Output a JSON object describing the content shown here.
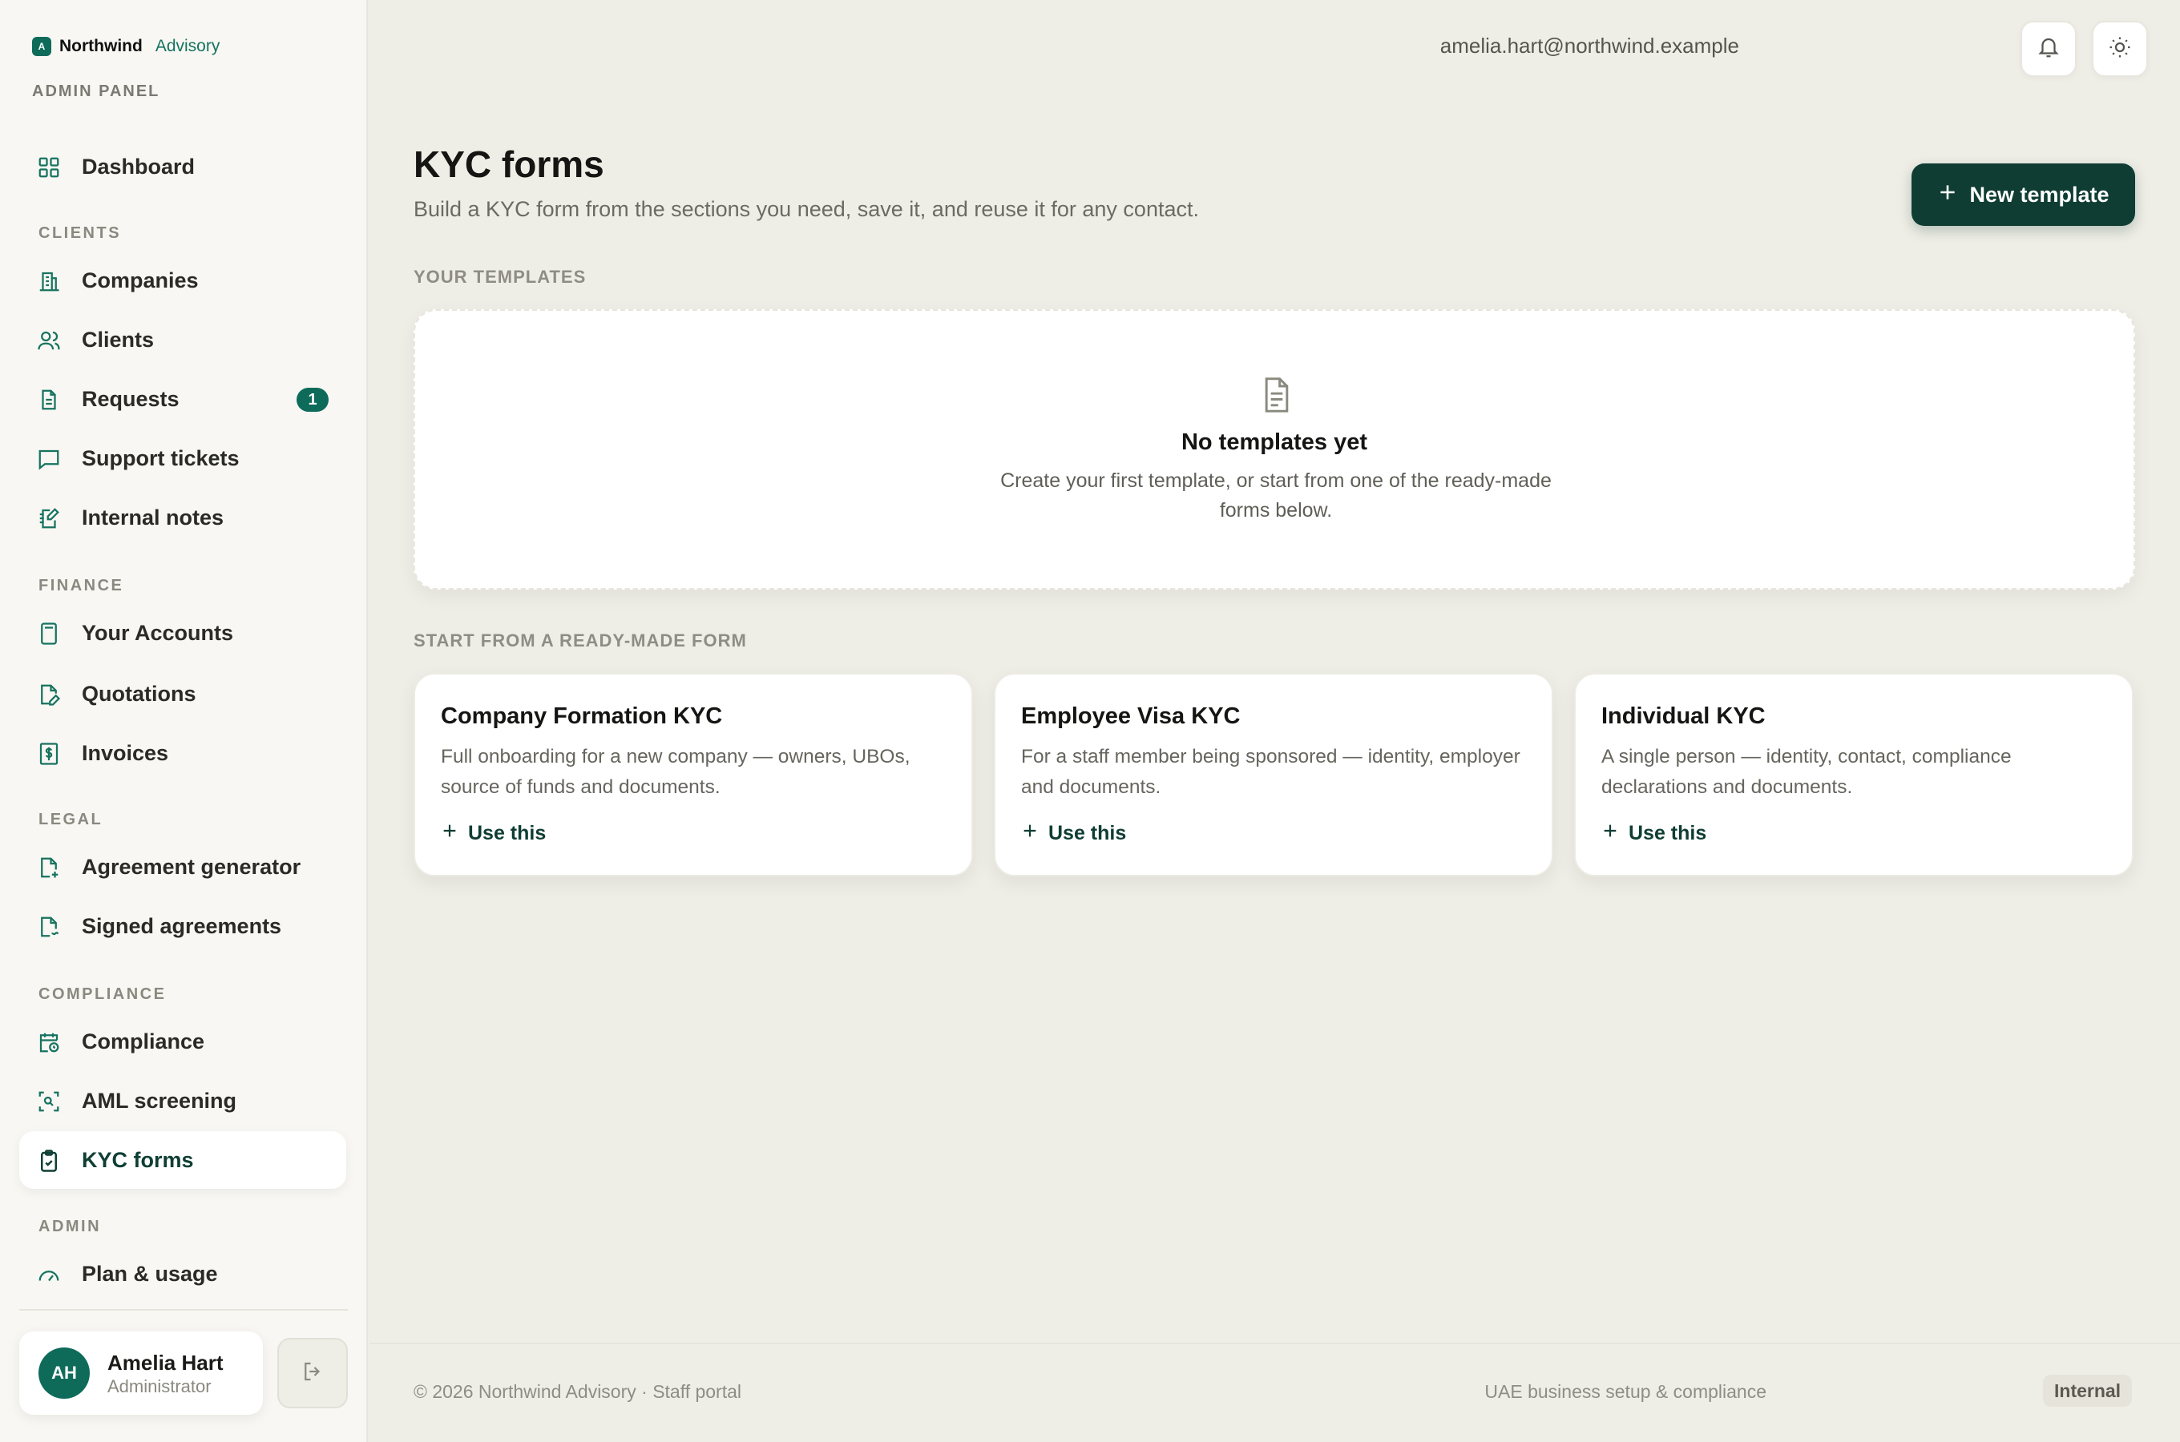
{
  "brand": {
    "name": "Northwind",
    "sub": "Advisory",
    "logo_letter": "A"
  },
  "panel_label": "ADMIN PANEL",
  "nav": {
    "dashboard": "Dashboard",
    "sections": {
      "clients": "CLIENTS",
      "finance": "FINANCE",
      "legal": "LEGAL",
      "compliance": "COMPLIANCE",
      "admin": "ADMIN"
    },
    "companies": "Companies",
    "clients": "Clients",
    "requests": "Requests",
    "requests_badge": "1",
    "support": "Support tickets",
    "notes": "Internal notes",
    "accounts": "Your Accounts",
    "quotations": "Quotations",
    "invoices": "Invoices",
    "agreement_gen": "Agreement generator",
    "signed": "Signed agreements",
    "compliance": "Compliance",
    "aml": "AML screening",
    "kyc": "KYC forms",
    "plan": "Plan & usage"
  },
  "user": {
    "initials": "AH",
    "name": "Amelia Hart",
    "role": "Administrator"
  },
  "topbar": {
    "email": "amelia.hart@northwind.example"
  },
  "page": {
    "title": "KYC forms",
    "subtitle": "Build a KYC form from the sections you need, save it, and reuse it for any contact.",
    "new_button": "New template"
  },
  "your_templates": {
    "label": "YOUR TEMPLATES",
    "empty_title": "No templates yet",
    "empty_text": "Create your first template, or start from one of the ready-made forms below."
  },
  "ready_made": {
    "label": "START FROM A READY-MADE FORM",
    "use_label": "Use this",
    "cards": [
      {
        "title": "Company Formation KYC",
        "desc": "Full onboarding for a new company — owners, UBOs, source of funds and documents."
      },
      {
        "title": "Employee Visa KYC",
        "desc": "For a staff member being sponsored — identity, employer and documents."
      },
      {
        "title": "Individual KYC",
        "desc": "A single person — identity, contact, compliance declarations and documents."
      }
    ]
  },
  "footer": {
    "left": "© 2026 Northwind Advisory · Staff portal",
    "right": "UAE business setup & compliance",
    "tag": "Internal"
  },
  "colors": {
    "accent": "#0e6b5a",
    "primary_button": "#0f3d33",
    "background": "#efeee6"
  }
}
